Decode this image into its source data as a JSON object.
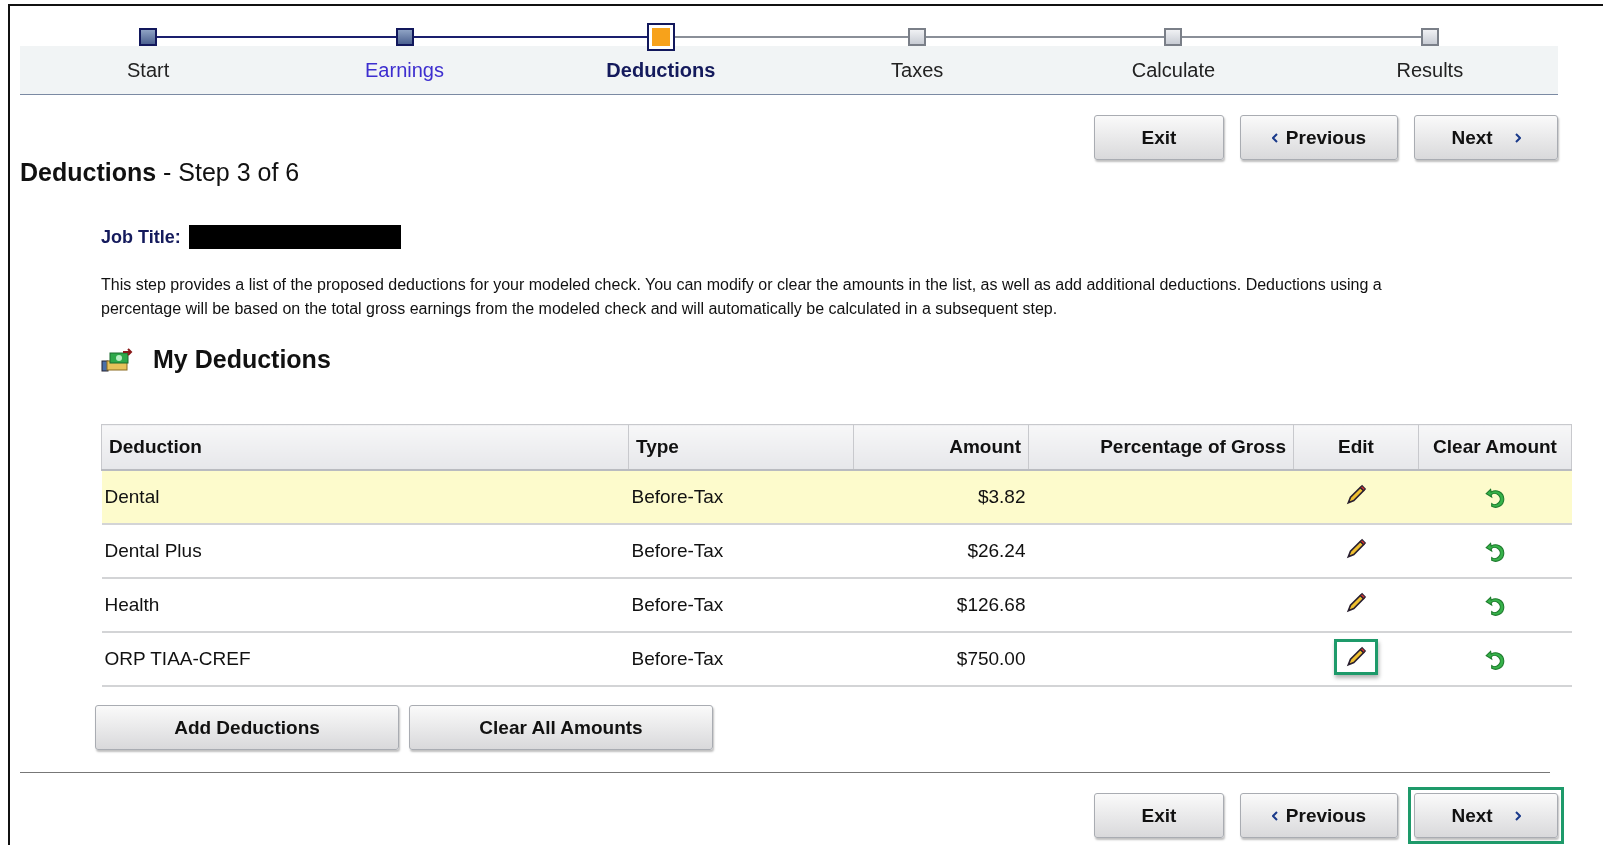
{
  "steps": [
    {
      "label": "Start",
      "completed": true,
      "link": false,
      "selected": false
    },
    {
      "label": "Earnings",
      "completed": true,
      "link": true,
      "selected": false
    },
    {
      "label": "Deductions",
      "completed": false,
      "link": false,
      "selected": true
    },
    {
      "label": "Taxes",
      "completed": false,
      "link": false,
      "selected": false
    },
    {
      "label": "Calculate",
      "completed": false,
      "link": false,
      "selected": false
    },
    {
      "label": "Results",
      "completed": false,
      "link": false,
      "selected": false
    }
  ],
  "top_buttons": [
    {
      "label": "Exit",
      "kind": "plain",
      "highlighted": false
    },
    {
      "label": "Previous",
      "kind": "previous",
      "highlighted": false
    },
    {
      "label": "Next",
      "kind": "next",
      "highlighted": false
    }
  ],
  "page_title": {
    "bold": "Deductions",
    "rest": "- Step 3 of 6"
  },
  "job_title": {
    "label": "Job Title:",
    "redacted": true
  },
  "description": "This step provides a list of the proposed deductions for your modeled check. You can modify or clear the amounts in the list, as well as add additional deductions. Deductions using a percentage will be based on the total gross earnings from the modeled check and will automatically be calculated in a subsequent step.",
  "section_title": "My Deductions",
  "table": {
    "columns": [
      "Deduction",
      "Type",
      "Amount",
      "Percentage of Gross",
      "Edit",
      "Clear Amount"
    ],
    "rows": [
      {
        "deduction": "Dental",
        "type": "Before-Tax",
        "amount": "$3.82",
        "highlighted": true,
        "edit_highlighted": false
      },
      {
        "deduction": "Dental Plus",
        "type": "Before-Tax",
        "amount": "$26.24",
        "highlighted": false,
        "edit_highlighted": false
      },
      {
        "deduction": "Health",
        "type": "Before-Tax",
        "amount": "$126.68",
        "highlighted": false,
        "edit_highlighted": false
      },
      {
        "deduction": "ORP TIAA-CREF",
        "type": "Before-Tax",
        "amount": "$750.00",
        "highlighted": false,
        "edit_highlighted": true
      }
    ]
  },
  "table_buttons": [
    "Add Deductions",
    "Clear All Amounts"
  ],
  "bottom_buttons": [
    {
      "label": "Exit",
      "kind": "plain",
      "highlighted": false
    },
    {
      "label": "Previous",
      "kind": "previous",
      "highlighted": false
    },
    {
      "label": "Next",
      "kind": "next",
      "highlighted": true
    }
  ]
}
